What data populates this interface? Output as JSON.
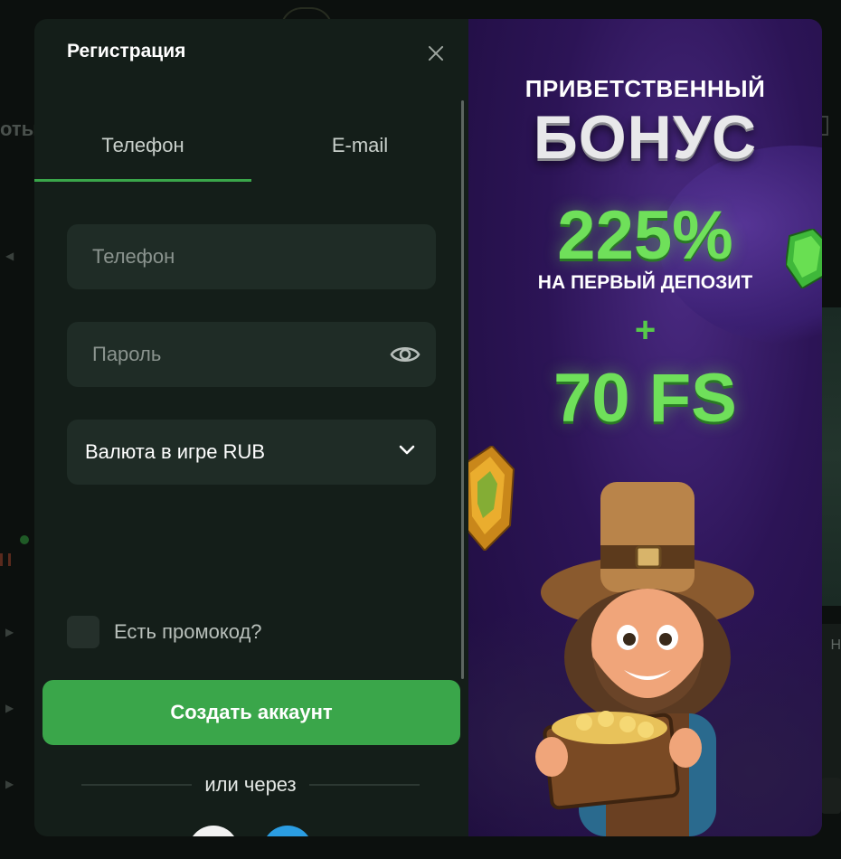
{
  "background": {
    "left_text": "оты",
    "right_text": "Н"
  },
  "modal": {
    "title": "Регистрация",
    "tabs": [
      {
        "label": "Телефон",
        "active": true
      },
      {
        "label": "E-mail",
        "active": false
      }
    ],
    "phone_placeholder": "Телефон",
    "password_placeholder": "Пароль",
    "currency_select": "Валюта в игре RUB",
    "promo_label": "Есть промокод?",
    "create_button": "Создать аккаунт",
    "or_text": "или через"
  },
  "banner": {
    "line1": "ПРИВЕТСТВЕННЫЙ",
    "line2": "БОНУС",
    "line3": "225%",
    "line4": "НА ПЕРВЫЙ ДЕПОЗИТ",
    "plus": "+",
    "line5": "70 FS"
  },
  "colors": {
    "accent": "#3aa64a",
    "panel": "#141e19",
    "field": "#1f2c26",
    "banner_purple": "#2c1456",
    "bonus_green": "#6fe05a"
  },
  "icons": [
    "close-icon",
    "eye-icon",
    "chevron-down-icon",
    "checkbox-icon"
  ]
}
